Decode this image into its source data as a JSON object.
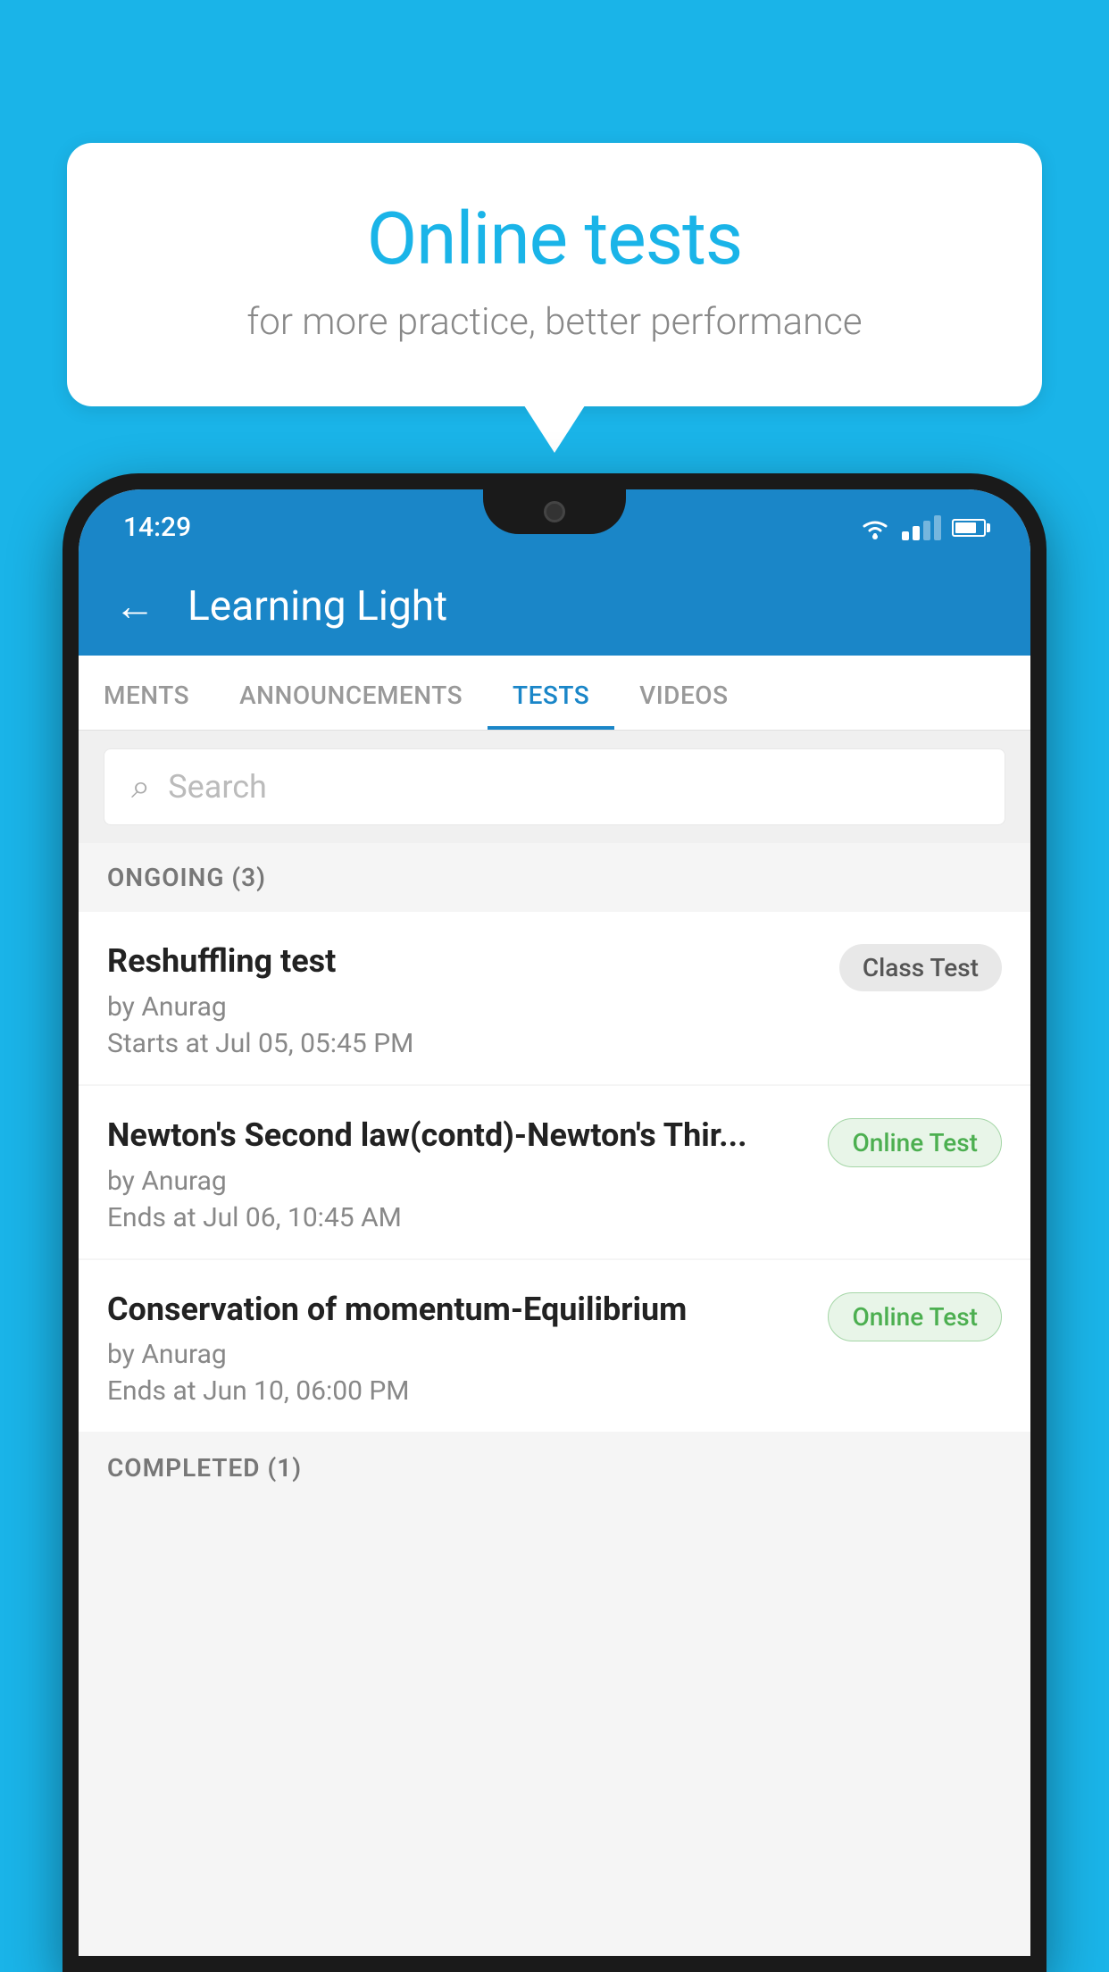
{
  "background_color": "#1ab4e8",
  "speech_bubble": {
    "title": "Online tests",
    "subtitle": "for more practice, better performance"
  },
  "status_bar": {
    "time": "14:29"
  },
  "header": {
    "title": "Learning Light",
    "back_label": "←"
  },
  "tabs": [
    {
      "label": "MENTS",
      "active": false
    },
    {
      "label": "ANNOUNCEMENTS",
      "active": false
    },
    {
      "label": "TESTS",
      "active": true
    },
    {
      "label": "VIDEOS",
      "active": false
    }
  ],
  "search": {
    "placeholder": "Search"
  },
  "sections": [
    {
      "title": "ONGOING (3)",
      "tests": [
        {
          "name": "Reshuffling test",
          "author": "by Anurag",
          "time_label": "Starts at",
          "time": "Jul 05, 05:45 PM",
          "badge": "Class Test",
          "badge_type": "class"
        },
        {
          "name": "Newton's Second law(contd)-Newton's Thir...",
          "author": "by Anurag",
          "time_label": "Ends at",
          "time": "Jul 06, 10:45 AM",
          "badge": "Online Test",
          "badge_type": "online"
        },
        {
          "name": "Conservation of momentum-Equilibrium",
          "author": "by Anurag",
          "time_label": "Ends at",
          "time": "Jun 10, 06:00 PM",
          "badge": "Online Test",
          "badge_type": "online"
        }
      ]
    }
  ],
  "completed_section": {
    "title": "COMPLETED (1)"
  },
  "icons": {
    "back": "←",
    "search": "🔍"
  }
}
